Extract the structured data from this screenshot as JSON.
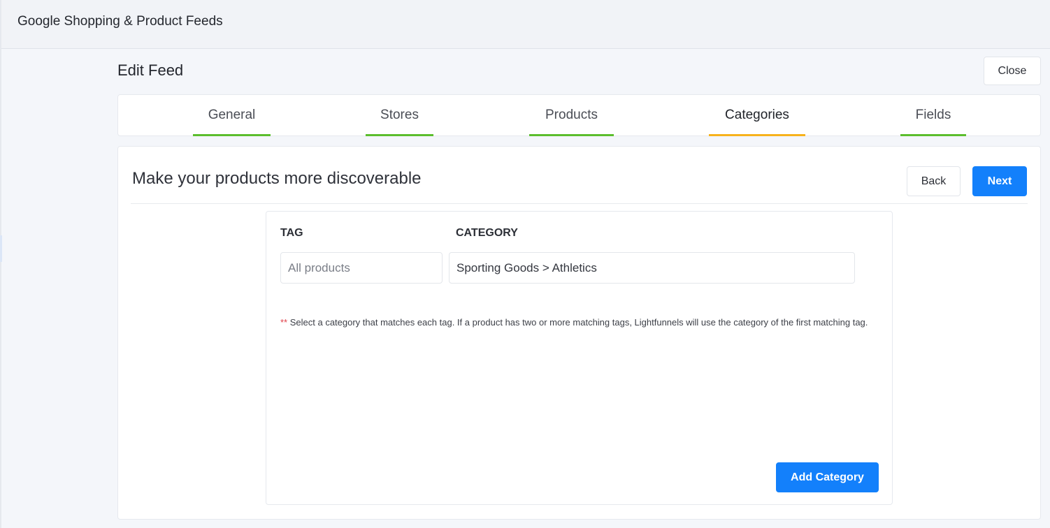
{
  "app": {
    "title": "Google Shopping & Product Feeds"
  },
  "page": {
    "title": "Edit Feed",
    "close_label": "Close"
  },
  "tabs": [
    {
      "label": "General",
      "state": "complete"
    },
    {
      "label": "Stores",
      "state": "complete"
    },
    {
      "label": "Products",
      "state": "complete"
    },
    {
      "label": "Categories",
      "state": "active"
    },
    {
      "label": "Fields",
      "state": "complete"
    }
  ],
  "colors": {
    "primary": "#1380fb",
    "tab_complete": "#5cbe2e",
    "tab_active": "#f7b21c",
    "note_marker": "#e0404a"
  },
  "section": {
    "title": "Make your products more discoverable",
    "back_label": "Back",
    "next_label": "Next"
  },
  "mapping": {
    "tag_header": "TAG",
    "category_header": "CATEGORY",
    "rows": [
      {
        "tag_placeholder": "All products",
        "category_value": "Sporting Goods > Athletics"
      }
    ],
    "note_marker": "**",
    "note_text": " Select a category that matches each tag. If a product has two or more matching tags, Lightfunnels will use the category of the first matching tag.",
    "add_label": "Add Category"
  }
}
